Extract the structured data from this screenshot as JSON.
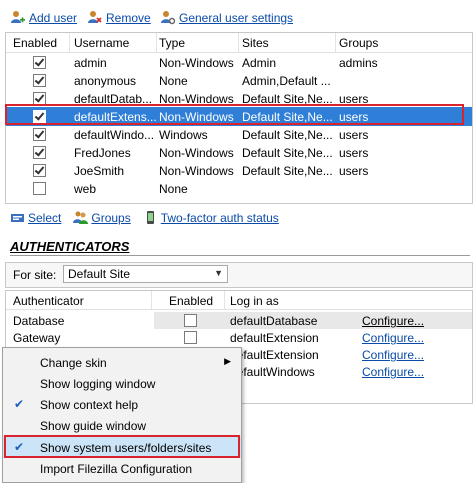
{
  "toolbar": {
    "add_user": "Add user",
    "remove": "Remove",
    "general_settings": "General user settings"
  },
  "users_table": {
    "headers": [
      "Enabled",
      "Username",
      "Type",
      "Sites",
      "Groups"
    ],
    "rows": [
      {
        "enabled": true,
        "username": "admin",
        "type": "Non-Windows",
        "sites": "Admin",
        "groups": "admins"
      },
      {
        "enabled": true,
        "username": "anonymous",
        "type": "None",
        "sites": "Admin,Default ...",
        "groups": ""
      },
      {
        "enabled": true,
        "username": "defaultDatab...",
        "type": "Non-Windows",
        "sites": "Default Site,Ne...",
        "groups": "users"
      },
      {
        "enabled": true,
        "username": "defaultExtens...",
        "type": "Non-Windows",
        "sites": "Default Site,Ne...",
        "groups": "users",
        "selected": true
      },
      {
        "enabled": true,
        "username": "defaultWindo...",
        "type": "Windows",
        "sites": "Default Site,Ne...",
        "groups": "users"
      },
      {
        "enabled": true,
        "username": "FredJones",
        "type": "Non-Windows",
        "sites": "Default Site,Ne...",
        "groups": "users"
      },
      {
        "enabled": true,
        "username": "JoeSmith",
        "type": "Non-Windows",
        "sites": "Default Site,Ne...",
        "groups": "users"
      },
      {
        "enabled": false,
        "username": "web",
        "type": "None",
        "sites": "",
        "groups": ""
      }
    ]
  },
  "toolbar2": {
    "select": "Select",
    "groups": "Groups",
    "two_factor": "Two-factor auth status"
  },
  "authenticators": {
    "title": "AUTHENTICATORS",
    "for_site_label": "For site:",
    "for_site_value": "Default Site",
    "headers": [
      "Authenticator",
      "Enabled",
      "Log in as"
    ],
    "rows": [
      {
        "name": "Database",
        "login": "defaultDatabase",
        "action": "Configure..."
      },
      {
        "name": "Gateway",
        "login": "defaultExtension",
        "action": "Configure..."
      },
      {
        "name": "",
        "login": "defaultExtension",
        "action": "Configure..."
      },
      {
        "name": "",
        "login": "defaultWindows",
        "action": "Configure..."
      }
    ]
  },
  "context_menu": {
    "items": [
      {
        "label": "Change skin",
        "checked": false,
        "submenu": true
      },
      {
        "label": "Show logging window",
        "checked": false
      },
      {
        "label": "Show context help",
        "checked": true
      },
      {
        "label": "Show guide window",
        "checked": false
      },
      {
        "label": "Show system users/folders/sites",
        "checked": true
      },
      {
        "label": "Import Filezilla Configuration",
        "checked": false
      }
    ]
  },
  "colors": {
    "link": "#0b4ba8",
    "selection": "#2f7fd8",
    "highlight_box": "#d9242e",
    "menu_hover": "#cce4f7"
  },
  "icons": [
    "user-add-icon",
    "user-remove-icon",
    "user-settings-icon",
    "select-icon",
    "groups-icon",
    "phone-icon",
    "check-icon",
    "submenu-arrow-icon",
    "dropdown-arrow-icon"
  ]
}
